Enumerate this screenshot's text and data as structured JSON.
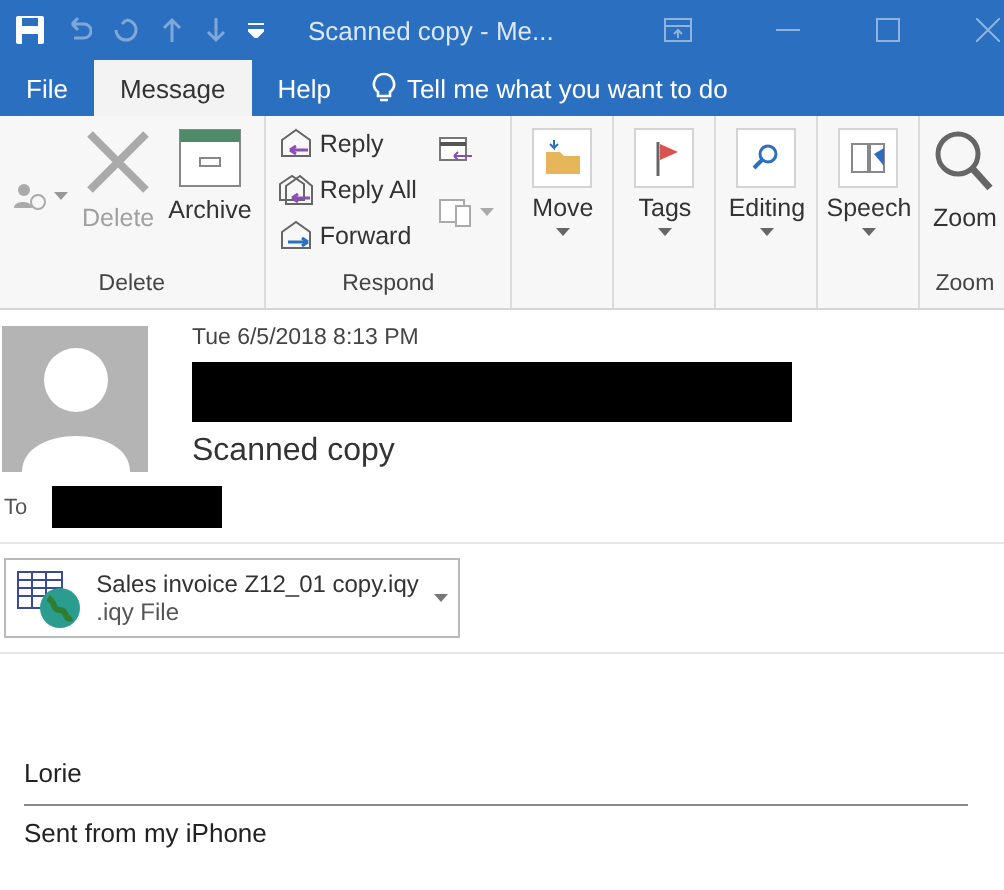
{
  "title_bar": {
    "title": "Scanned copy  -  Me..."
  },
  "tabs": [
    {
      "label": "File",
      "selected": false
    },
    {
      "label": "Message",
      "selected": true
    },
    {
      "label": "Help",
      "selected": false
    }
  ],
  "tell_me": {
    "placeholder": "Tell me what you want to do"
  },
  "ribbon": {
    "groups": [
      {
        "label": "Delete",
        "commands": [
          {
            "kind": "icon",
            "disabled": true
          },
          {
            "kind": "large",
            "label": "Delete",
            "disabled": true
          },
          {
            "kind": "large",
            "label": "Archive",
            "disabled": false
          }
        ]
      },
      {
        "label": "Respond",
        "commands": [
          {
            "kind": "small",
            "label": "Reply",
            "disabled": false
          },
          {
            "kind": "small",
            "label": "Reply All",
            "disabled": false
          },
          {
            "kind": "small",
            "label": "Forward",
            "disabled": false
          }
        ]
      },
      {
        "commands": [
          {
            "kind": "menu",
            "label": "Move",
            "disabled": false
          }
        ]
      },
      {
        "commands": [
          {
            "kind": "menu",
            "label": "Tags",
            "disabled": false
          }
        ]
      },
      {
        "commands": [
          {
            "kind": "menu",
            "label": "Editing",
            "disabled": false
          }
        ]
      },
      {
        "commands": [
          {
            "kind": "menu",
            "label": "Speech",
            "disabled": false
          }
        ]
      },
      {
        "label": "Zoom",
        "commands": [
          {
            "kind": "large",
            "label": "Zoom",
            "disabled": false
          }
        ]
      }
    ]
  },
  "message": {
    "date": "Tue 6/5/2018 8:13 PM",
    "subject": "Scanned copy",
    "to_label": "To"
  },
  "attachment": {
    "name": "Sales invoice Z12_01 copy.iqy",
    "type": ".iqy File"
  },
  "body": [
    {
      "text": "Lorie"
    },
    {
      "text": "Sent from my iPhone"
    }
  ]
}
